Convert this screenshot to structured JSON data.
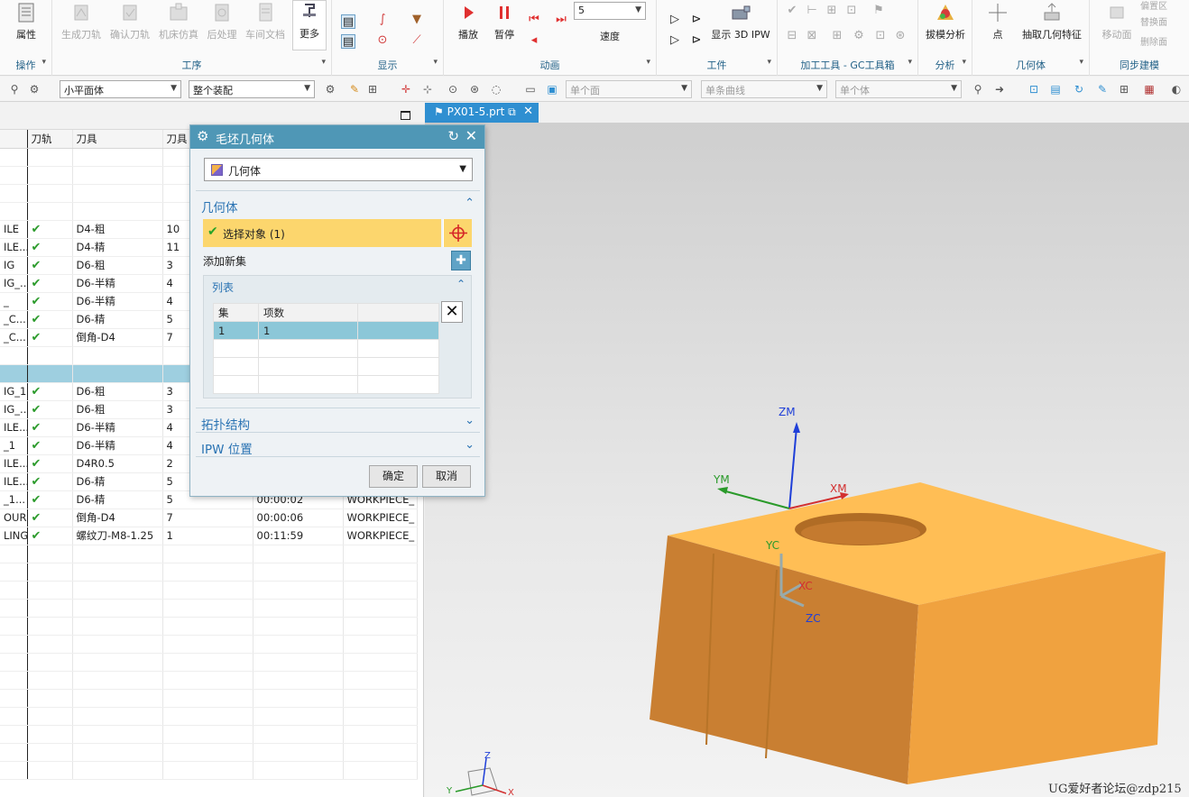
{
  "ribbon": {
    "groups": [
      {
        "label": "操作",
        "buttons": [
          {
            "label": "属性",
            "icon": "properties-icon"
          }
        ]
      },
      {
        "label": "工序",
        "buttons": [
          {
            "label": "生成刀轨",
            "icon": "generate-path-icon"
          },
          {
            "label": "确认刀轨",
            "icon": "verify-path-icon"
          },
          {
            "label": "机床仿真",
            "icon": "machine-sim-icon"
          },
          {
            "label": "后处理",
            "icon": "postprocess-icon"
          },
          {
            "label": "车间文档",
            "icon": "shop-doc-icon"
          },
          {
            "label": "更多",
            "icon": "more-icon"
          }
        ]
      },
      {
        "label": "显示",
        "buttons": []
      },
      {
        "label": "动画",
        "buttons": [
          {
            "label": "播放",
            "icon": "play-icon"
          },
          {
            "label": "暂停",
            "icon": "pause-icon"
          },
          {
            "label": "速度",
            "icon": "speed-icon"
          }
        ],
        "speed_value": "5"
      },
      {
        "label": "工件",
        "buttons": [
          {
            "label": "显示 3D IPW",
            "icon": "ipw-icon"
          }
        ]
      },
      {
        "label": "加工工具 - GC工具箱",
        "buttons": []
      },
      {
        "label": "分析",
        "buttons": [
          {
            "label": "拔模分析",
            "icon": "draft-analysis-icon"
          }
        ]
      },
      {
        "label": "几何体",
        "buttons": [
          {
            "label": "点",
            "icon": "point-icon"
          },
          {
            "label": "抽取几何特征",
            "icon": "extract-geometry-icon"
          }
        ]
      },
      {
        "label": "同步建模",
        "buttons": [
          {
            "label": "移动面",
            "icon": "move-face-icon"
          },
          {
            "label": "偏置区",
            "icon": "offset-region-icon"
          },
          {
            "label": "替换面",
            "icon": "replace-face-icon"
          },
          {
            "label": "删除面",
            "icon": "delete-face-icon"
          }
        ]
      }
    ]
  },
  "toolbar2": {
    "filter1": "小平面体",
    "filter2": "整个装配",
    "face_rule": "单个面",
    "curve_rule": "单条曲线",
    "body_rule": "单个体"
  },
  "navigator": {
    "columns": [
      "",
      "刀轨",
      "刀具",
      "刀具",
      "",
      ""
    ],
    "rows": [
      {
        "name": "",
        "path": false,
        "tool": "",
        "num": "",
        "time": "",
        "geom": ""
      },
      {
        "name": "",
        "path": false,
        "tool": "",
        "num": "",
        "time": "",
        "geom": ""
      },
      {
        "name": "",
        "path": false,
        "tool": "",
        "num": "",
        "time": "",
        "geom": ""
      },
      {
        "name": "",
        "path": false,
        "tool": "",
        "num": "",
        "time": "",
        "geom": ""
      },
      {
        "name": "ILE",
        "path": true,
        "tool": "D4-粗",
        "num": "10",
        "time": "",
        "geom": ""
      },
      {
        "name": "ILE...",
        "path": true,
        "tool": "D4-精",
        "num": "11",
        "time": "",
        "geom": ""
      },
      {
        "name": "IG",
        "path": true,
        "tool": "D6-粗",
        "num": "3",
        "time": "",
        "geom": ""
      },
      {
        "name": "IG_...",
        "path": true,
        "tool": "D6-半精",
        "num": "4",
        "time": "",
        "geom": ""
      },
      {
        "name": "_",
        "path": true,
        "tool": "D6-半精",
        "num": "4",
        "time": "",
        "geom": ""
      },
      {
        "name": "_C...",
        "path": true,
        "tool": "D6-精",
        "num": "5",
        "time": "",
        "geom": ""
      },
      {
        "name": "_C...",
        "path": true,
        "tool": "倒角-D4",
        "num": "7",
        "time": "",
        "geom": ""
      },
      {
        "name": "",
        "path": false,
        "tool": "",
        "num": "",
        "time": "",
        "geom": ""
      },
      {
        "name": "",
        "path": false,
        "tool": "",
        "num": "",
        "time": "",
        "geom": "",
        "selected": true
      },
      {
        "name": "IG_1",
        "path": true,
        "tool": "D6-粗",
        "num": "3",
        "time": "",
        "geom": ""
      },
      {
        "name": "IG_...",
        "path": true,
        "tool": "D6-粗",
        "num": "3",
        "time": "",
        "geom": ""
      },
      {
        "name": "ILE...",
        "path": true,
        "tool": "D6-半精",
        "num": "4",
        "time": "",
        "geom": ""
      },
      {
        "name": "_1",
        "path": true,
        "tool": "D6-半精",
        "num": "4",
        "time": "",
        "geom": ""
      },
      {
        "name": "ILE...",
        "path": true,
        "tool": "D4R0.5",
        "num": "2",
        "time": "",
        "geom": ""
      },
      {
        "name": "ILE...",
        "path": true,
        "tool": "D6-精",
        "num": "5",
        "time": "",
        "geom": ""
      },
      {
        "name": "_1...",
        "path": true,
        "tool": "D6-精",
        "num": "5",
        "time": "00:00:02",
        "geom": "WORKPIECE_"
      },
      {
        "name": "OUR",
        "path": true,
        "tool": "倒角-D4",
        "num": "7",
        "time": "00:00:06",
        "geom": "WORKPIECE_"
      },
      {
        "name": "LING",
        "path": true,
        "tool": "螺纹刀-M8-1.25",
        "num": "1",
        "time": "00:11:59",
        "geom": "WORKPIECE_"
      }
    ],
    "empty_rows": 13
  },
  "tab": {
    "label": "PX01-5.prt"
  },
  "dialog": {
    "title": "毛坯几何体",
    "type_value": "几何体",
    "section_geometry": "几何体",
    "select_object": "选择对象 (1)",
    "add_new_set": "添加新集",
    "list_label": "列表",
    "list_headers": [
      "集",
      "项数",
      ""
    ],
    "list_rows": [
      [
        "1",
        "1",
        ""
      ]
    ],
    "section_topology": "拓扑结构",
    "section_ipw": "IPW 位置",
    "ok": "确定",
    "cancel": "取消"
  },
  "viewport": {
    "axis_labels": {
      "zm": "ZM",
      "ym": "YM",
      "xm": "XM",
      "yc": "YC",
      "xc": "XC",
      "zc": "ZC",
      "z": "Z",
      "y": "Y",
      "x": "X"
    },
    "part_color": "#f2a948"
  },
  "watermark": "UG爱好者论坛@zdp215"
}
